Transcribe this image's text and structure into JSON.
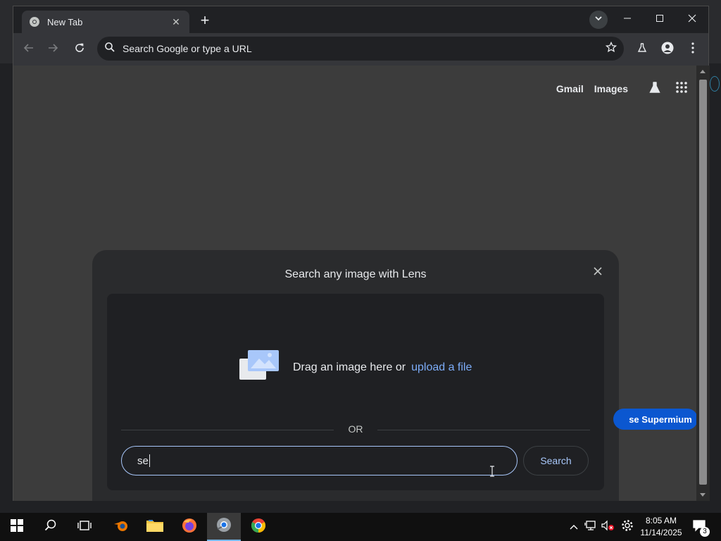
{
  "browser": {
    "tab": {
      "title": "New Tab",
      "close_symbol": "✕"
    },
    "new_tab_symbol": "+",
    "omnibox": {
      "text": "Search Google or type a URL"
    },
    "ntp": {
      "links": [
        "Gmail",
        "Images"
      ]
    },
    "supermium_button": "se Supermium"
  },
  "lens_dialog": {
    "title": "Search any image with Lens",
    "drop_text": "Drag an image here or",
    "upload_link": "upload a file",
    "or_label": "OR",
    "input_value": "se",
    "search_button": "Search"
  },
  "taskbar": {
    "clock_time": "8:05 AM",
    "clock_date": "11/14/2025",
    "notification_count": "3"
  },
  "colors": {
    "accent_link": "#7cacf8",
    "input_border": "#a8c7fa",
    "supermium_blue": "#0b57d0"
  },
  "icons": [
    "chrome-icon",
    "close-icon",
    "plus-icon",
    "chevron-down-icon",
    "minimize-icon",
    "maximize-icon",
    "back-icon",
    "forward-icon",
    "reload-icon",
    "search-icon",
    "star-icon",
    "flask-icon",
    "profile-icon",
    "menu-icon",
    "apps-grid-icon",
    "image-icon",
    "windows-start-icon",
    "blender-icon",
    "folder-icon",
    "firefox-icon",
    "chromium-icon",
    "chrome-app-icon",
    "network-icon",
    "volume-icon",
    "settings-icon",
    "notifications-icon"
  ]
}
